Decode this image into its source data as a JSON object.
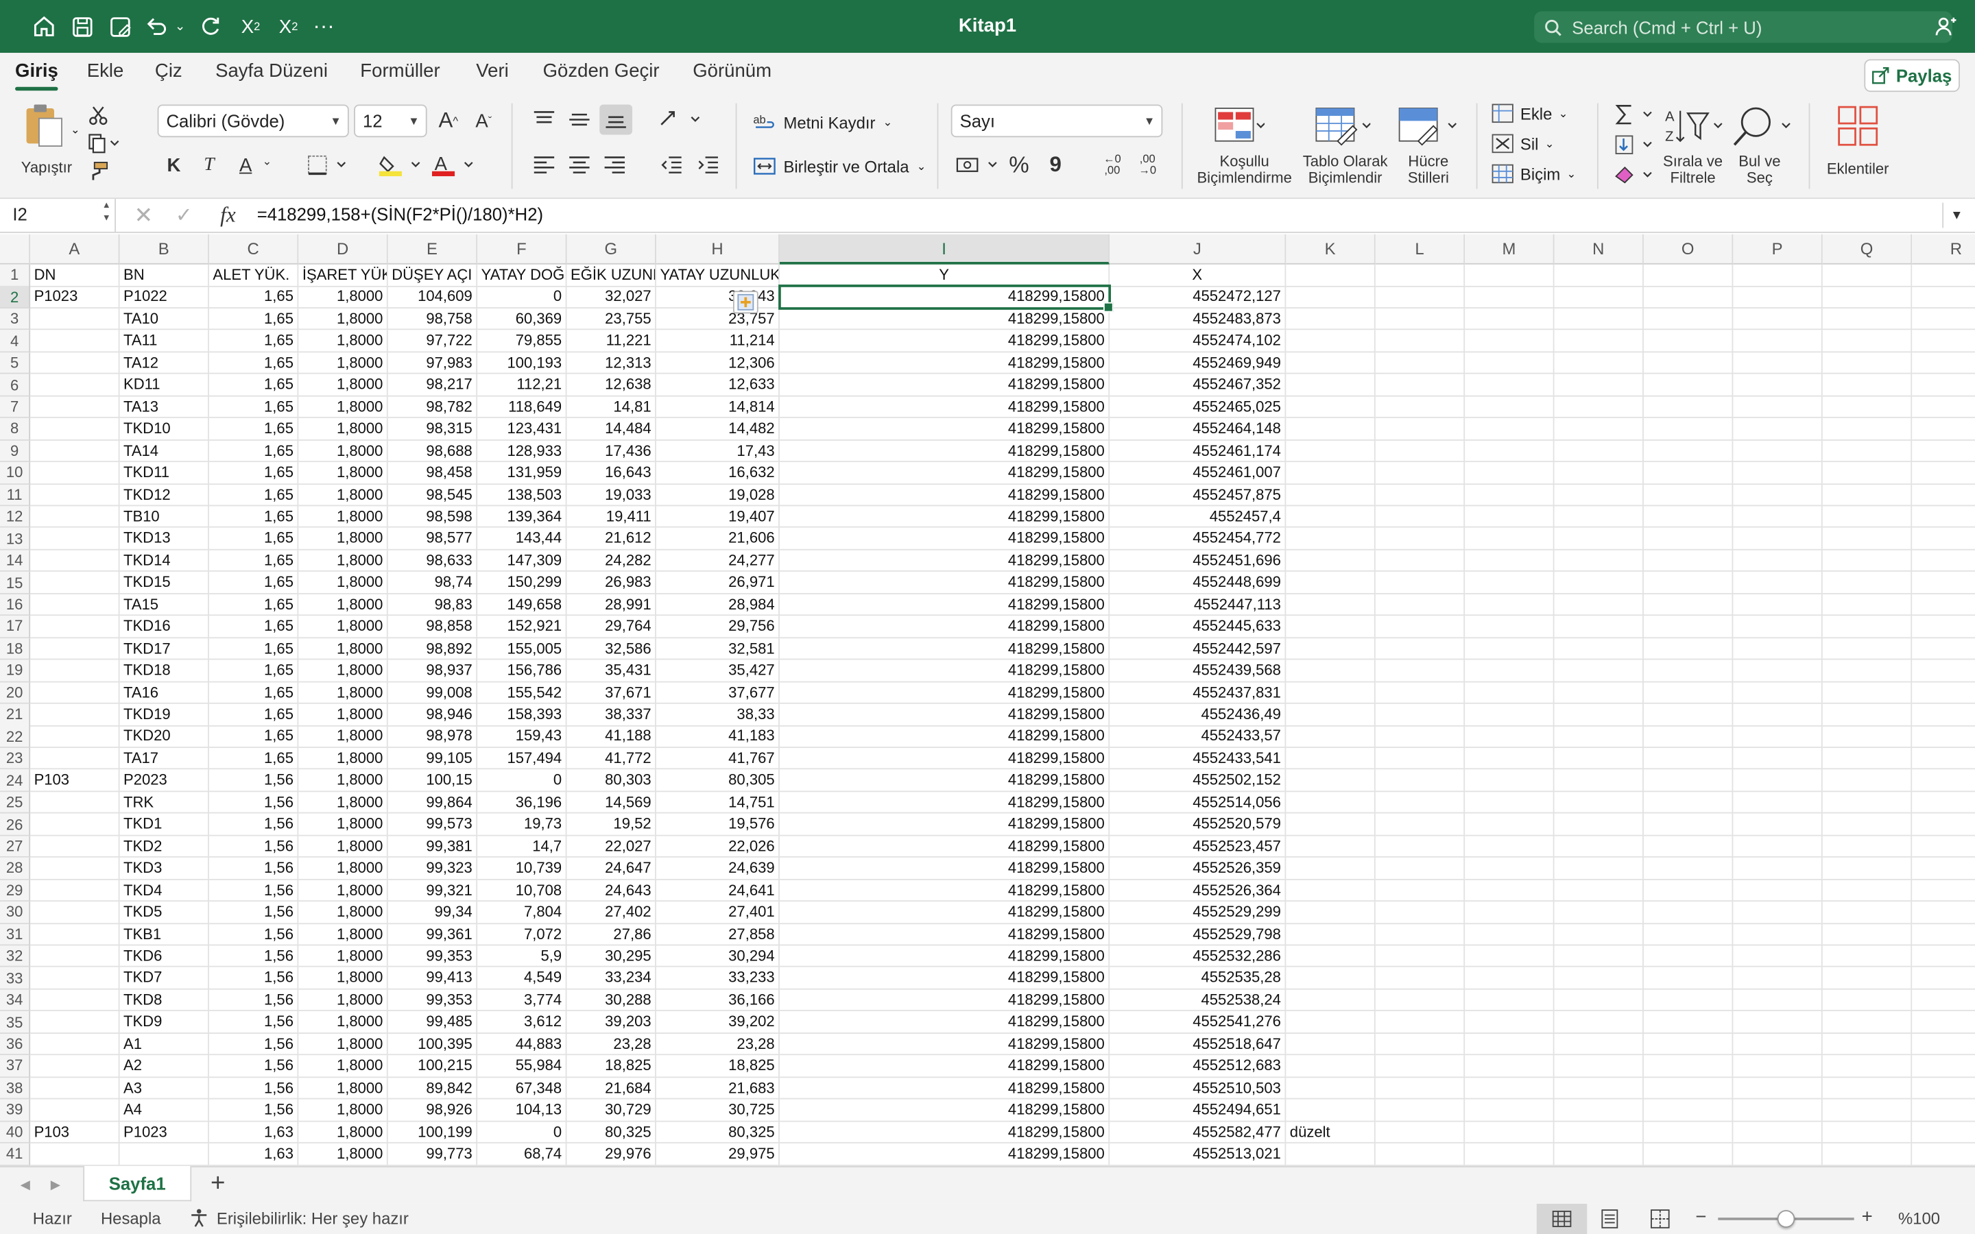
{
  "titlebar": {
    "title": "Kitap1",
    "search_placeholder": "Search (Cmd + Ctrl + U)",
    "icons": [
      "home-icon",
      "save-icon",
      "save-as-icon",
      "undo-icon",
      "redo-icon",
      "subscript-icon",
      "superscript-icon",
      "more-icon",
      "share-people-icon"
    ],
    "color": "#1e7145"
  },
  "menu": {
    "tabs": [
      "Giriş",
      "Ekle",
      "Çiz",
      "Sayfa Düzeni",
      "Formüller",
      "Veri",
      "Gözden Geçir",
      "Görünüm"
    ],
    "active": "Giriş",
    "share_label": "Paylaş"
  },
  "ribbon": {
    "paste_label": "Yapıştır",
    "font_name": "Calibri (Gövde)",
    "font_size": "12",
    "bold": "K",
    "italic": "T",
    "underline": "A",
    "wrap_text": "Metni Kaydır",
    "merge_center": "Birleştir ve Ortala",
    "number_format": "Sayı",
    "percent": "%",
    "comma": "9",
    "conditional_formatting": [
      "Koşullu",
      "Biçimlendirme"
    ],
    "format_as_table": [
      "Tablo Olarak",
      "Biçimlendir"
    ],
    "cell_styles": [
      "Hücre",
      "Stilleri"
    ],
    "insert": "Ekle",
    "delete": "Sil",
    "format": "Biçim",
    "sort_filter": [
      "Sırala ve",
      "Filtrele"
    ],
    "find_select": [
      "Bul ve",
      "Seç"
    ],
    "addins": "Eklentiler"
  },
  "formula_bar": {
    "name_box": "I2",
    "fx": "fx",
    "formula": "=418299,158+(SİN(F2*Pİ()/180)*H2)"
  },
  "sheet": {
    "columns": [
      "A",
      "B",
      "C",
      "D",
      "E",
      "F",
      "G",
      "H",
      "I",
      "J",
      "K",
      "L",
      "M",
      "N",
      "O",
      "P",
      "Q",
      "R"
    ],
    "selected_column": "I",
    "selected_row": 2,
    "header_row": [
      "DN",
      "BN",
      "ALET YÜK.",
      "İŞARET YÜK.",
      "DÜŞEY AÇI",
      "YATAY DOĞRULTU",
      "EĞİK UZUNLUK",
      "YATAY UZUNLUK",
      "Y",
      "X",
      "",
      "",
      "",
      "",
      "",
      "",
      "",
      ""
    ],
    "rows": [
      [
        "P1023",
        "P1022",
        "1,65",
        "1,8000",
        "104,609",
        "0",
        "32,027",
        "32,943",
        "418299,15800",
        "4552472,127",
        ""
      ],
      [
        "",
        "TA10",
        "1,65",
        "1,8000",
        "98,758",
        "60,369",
        "23,755",
        "23,757",
        "418299,15800",
        "4552483,873",
        ""
      ],
      [
        "",
        "TA11",
        "1,65",
        "1,8000",
        "97,722",
        "79,855",
        "11,221",
        "11,214",
        "418299,15800",
        "4552474,102",
        ""
      ],
      [
        "",
        "TA12",
        "1,65",
        "1,8000",
        "97,983",
        "100,193",
        "12,313",
        "12,306",
        "418299,15800",
        "4552469,949",
        ""
      ],
      [
        "",
        "KD11",
        "1,65",
        "1,8000",
        "98,217",
        "112,21",
        "12,638",
        "12,633",
        "418299,15800",
        "4552467,352",
        ""
      ],
      [
        "",
        "TA13",
        "1,65",
        "1,8000",
        "98,782",
        "118,649",
        "14,81",
        "14,814",
        "418299,15800",
        "4552465,025",
        ""
      ],
      [
        "",
        "TKD10",
        "1,65",
        "1,8000",
        "98,315",
        "123,431",
        "14,484",
        "14,482",
        "418299,15800",
        "4552464,148",
        ""
      ],
      [
        "",
        "TA14",
        "1,65",
        "1,8000",
        "98,688",
        "128,933",
        "17,436",
        "17,43",
        "418299,15800",
        "4552461,174",
        ""
      ],
      [
        "",
        "TKD11",
        "1,65",
        "1,8000",
        "98,458",
        "131,959",
        "16,643",
        "16,632",
        "418299,15800",
        "4552461,007",
        ""
      ],
      [
        "",
        "TKD12",
        "1,65",
        "1,8000",
        "98,545",
        "138,503",
        "19,033",
        "19,028",
        "418299,15800",
        "4552457,875",
        ""
      ],
      [
        "",
        "TB10",
        "1,65",
        "1,8000",
        "98,598",
        "139,364",
        "19,411",
        "19,407",
        "418299,15800",
        "4552457,4",
        ""
      ],
      [
        "",
        "TKD13",
        "1,65",
        "1,8000",
        "98,577",
        "143,44",
        "21,612",
        "21,606",
        "418299,15800",
        "4552454,772",
        ""
      ],
      [
        "",
        "TKD14",
        "1,65",
        "1,8000",
        "98,633",
        "147,309",
        "24,282",
        "24,277",
        "418299,15800",
        "4552451,696",
        ""
      ],
      [
        "",
        "TKD15",
        "1,65",
        "1,8000",
        "98,74",
        "150,299",
        "26,983",
        "26,971",
        "418299,15800",
        "4552448,699",
        ""
      ],
      [
        "",
        "TA15",
        "1,65",
        "1,8000",
        "98,83",
        "149,658",
        "28,991",
        "28,984",
        "418299,15800",
        "4552447,113",
        ""
      ],
      [
        "",
        "TKD16",
        "1,65",
        "1,8000",
        "98,858",
        "152,921",
        "29,764",
        "29,756",
        "418299,15800",
        "4552445,633",
        ""
      ],
      [
        "",
        "TKD17",
        "1,65",
        "1,8000",
        "98,892",
        "155,005",
        "32,586",
        "32,581",
        "418299,15800",
        "4552442,597",
        ""
      ],
      [
        "",
        "TKD18",
        "1,65",
        "1,8000",
        "98,937",
        "156,786",
        "35,431",
        "35,427",
        "418299,15800",
        "4552439,568",
        ""
      ],
      [
        "",
        "TA16",
        "1,65",
        "1,8000",
        "99,008",
        "155,542",
        "37,671",
        "37,677",
        "418299,15800",
        "4552437,831",
        ""
      ],
      [
        "",
        "TKD19",
        "1,65",
        "1,8000",
        "98,946",
        "158,393",
        "38,337",
        "38,33",
        "418299,15800",
        "4552436,49",
        ""
      ],
      [
        "",
        "TKD20",
        "1,65",
        "1,8000",
        "98,978",
        "159,43",
        "41,188",
        "41,183",
        "418299,15800",
        "4552433,57",
        ""
      ],
      [
        "",
        "TA17",
        "1,65",
        "1,8000",
        "99,105",
        "157,494",
        "41,772",
        "41,767",
        "418299,15800",
        "4552433,541",
        ""
      ],
      [
        "P103",
        "P2023",
        "1,56",
        "1,8000",
        "100,15",
        "0",
        "80,303",
        "80,305",
        "418299,15800",
        "4552502,152",
        ""
      ],
      [
        "",
        "TRK",
        "1,56",
        "1,8000",
        "99,864",
        "36,196",
        "14,569",
        "14,751",
        "418299,15800",
        "4552514,056",
        ""
      ],
      [
        "",
        "TKD1",
        "1,56",
        "1,8000",
        "99,573",
        "19,73",
        "19,52",
        "19,576",
        "418299,15800",
        "4552520,579",
        ""
      ],
      [
        "",
        "TKD2",
        "1,56",
        "1,8000",
        "99,381",
        "14,7",
        "22,027",
        "22,026",
        "418299,15800",
        "4552523,457",
        ""
      ],
      [
        "",
        "TKD3",
        "1,56",
        "1,8000",
        "99,323",
        "10,739",
        "24,647",
        "24,639",
        "418299,15800",
        "4552526,359",
        ""
      ],
      [
        "",
        "TKD4",
        "1,56",
        "1,8000",
        "99,321",
        "10,708",
        "24,643",
        "24,641",
        "418299,15800",
        "4552526,364",
        ""
      ],
      [
        "",
        "TKD5",
        "1,56",
        "1,8000",
        "99,34",
        "7,804",
        "27,402",
        "27,401",
        "418299,15800",
        "4552529,299",
        ""
      ],
      [
        "",
        "TKB1",
        "1,56",
        "1,8000",
        "99,361",
        "7,072",
        "27,86",
        "27,858",
        "418299,15800",
        "4552529,798",
        ""
      ],
      [
        "",
        "TKD6",
        "1,56",
        "1,8000",
        "99,353",
        "5,9",
        "30,295",
        "30,294",
        "418299,15800",
        "4552532,286",
        ""
      ],
      [
        "",
        "TKD7",
        "1,56",
        "1,8000",
        "99,413",
        "4,549",
        "33,234",
        "33,233",
        "418299,15800",
        "4552535,28",
        ""
      ],
      [
        "",
        "TKD8",
        "1,56",
        "1,8000",
        "99,353",
        "3,774",
        "30,288",
        "36,166",
        "418299,15800",
        "4552538,24",
        ""
      ],
      [
        "",
        "TKD9",
        "1,56",
        "1,8000",
        "99,485",
        "3,612",
        "39,203",
        "39,202",
        "418299,15800",
        "4552541,276",
        ""
      ],
      [
        "",
        "A1",
        "1,56",
        "1,8000",
        "100,395",
        "44,883",
        "23,28",
        "23,28",
        "418299,15800",
        "4552518,647",
        ""
      ],
      [
        "",
        "A2",
        "1,56",
        "1,8000",
        "100,215",
        "55,984",
        "18,825",
        "18,825",
        "418299,15800",
        "4552512,683",
        ""
      ],
      [
        "",
        "A3",
        "1,56",
        "1,8000",
        "89,842",
        "67,348",
        "21,684",
        "21,683",
        "418299,15800",
        "4552510,503",
        ""
      ],
      [
        "",
        "A4",
        "1,56",
        "1,8000",
        "98,926",
        "104,13",
        "30,729",
        "30,725",
        "418299,15800",
        "4552494,651",
        ""
      ],
      [
        "P103",
        "P1023",
        "1,63",
        "1,8000",
        "100,199",
        "0",
        "80,325",
        "80,325",
        "418299,15800",
        "4552582,477",
        "düzelt"
      ],
      [
        "",
        "",
        "1,63",
        "1,8000",
        "99,773",
        "68,74",
        "29,976",
        "29,975",
        "418299,15800",
        "4552513,021",
        ""
      ]
    ]
  },
  "sheet_tabs": {
    "active": "Sayfa1",
    "add": "+"
  },
  "status": {
    "ready": "Hazır",
    "calculate": "Hesapla",
    "accessibility": "Erişilebilirlik: Her şey hazır",
    "zoom": "%100",
    "zoom_level": 1.0
  }
}
